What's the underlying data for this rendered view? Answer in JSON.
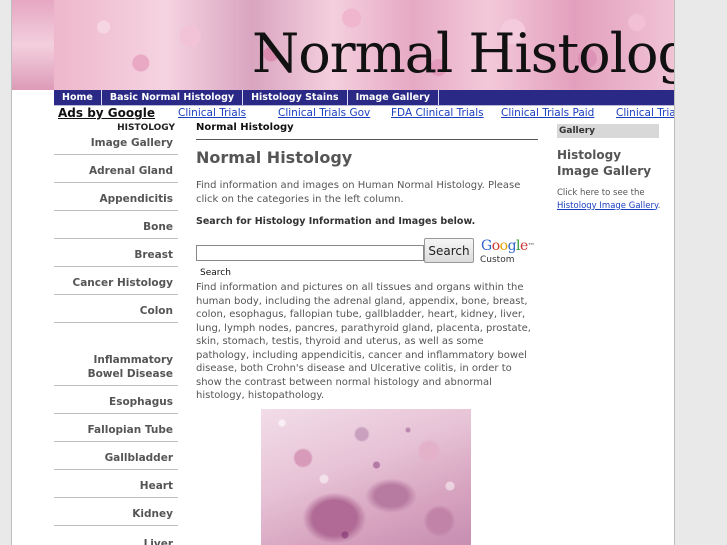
{
  "header": {
    "title": "Normal Histology"
  },
  "nav": {
    "items": [
      {
        "label": "Home"
      },
      {
        "label": "Basic Normal Histology"
      },
      {
        "label": "Histology Stains"
      },
      {
        "label": "Image Gallery"
      }
    ]
  },
  "ads": {
    "label": "Ads by Google",
    "links": [
      {
        "label": "Clinical Trials"
      },
      {
        "label": "Clinical Trials Gov"
      },
      {
        "label": "FDA Clinical Trials"
      },
      {
        "label": "Clinical Trials Paid"
      },
      {
        "label": "Clinical Trials"
      }
    ]
  },
  "sidebar": {
    "heading": "HISTOLOGY",
    "items": [
      {
        "label": "Image Gallery"
      },
      {
        "label": "Adrenal Gland"
      },
      {
        "label": "Appendicitis"
      },
      {
        "label": "Bone"
      },
      {
        "label": "Breast"
      },
      {
        "label": "Cancer Histology"
      },
      {
        "label": "Colon"
      },
      {
        "label": "Inflammatory\nBowel Disease"
      },
      {
        "label": "Esophagus"
      },
      {
        "label": "Fallopian Tube"
      },
      {
        "label": "Gallbladder"
      },
      {
        "label": "Heart"
      },
      {
        "label": "Kidney"
      },
      {
        "label": "Liver"
      }
    ]
  },
  "main": {
    "breadcrumb": "Normal Histology",
    "title": "Normal Histology",
    "intro": "Find information and images on Human Normal Histology. Please click on the categories in the left column.",
    "search_heading": "Search for Histology Information and Images below.",
    "search_value": "",
    "search_button": "Search",
    "google_sub": "Custom",
    "search_label": "Search",
    "body": "Find information and pictures on all tissues and organs within the human body, including the adrenal gland, appendix, bone, breast, colon, esophagus, fallopian tube, gallbladder, heart, kidney, liver, lung, lymph nodes, pancres, parathyroid gland, placenta, prostate, skin, stomach, testis, thyroid and uterus, as well as some pathology, including appendicitis, cancer and inflammatory bowel disease, both Crohn's disease and Ulcerative colitis, in order to show the contrast between normal histology and abnormal histology, histopathology."
  },
  "rightbar": {
    "tab": "Gallery",
    "title": "Histology Image Gallery",
    "text_before": "Click here to see the ",
    "link": "Histology Image Gallery",
    "text_after": "."
  },
  "colors": {
    "nav_bg": "#2a2a86",
    "link": "#1a3fbf",
    "text_gray": "#555555"
  }
}
